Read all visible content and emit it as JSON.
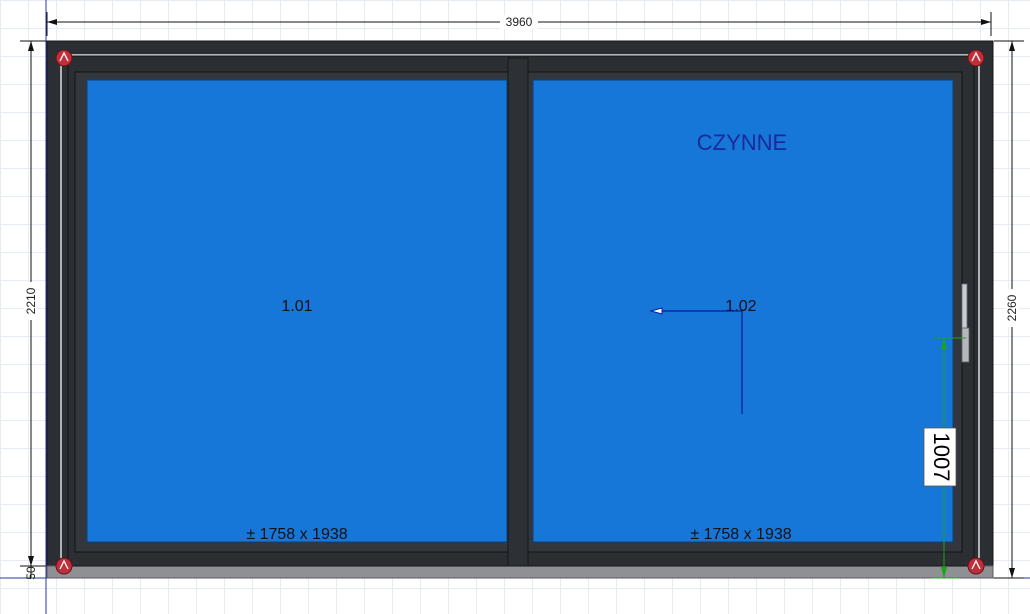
{
  "dimensions": {
    "total_width": "3960",
    "frame_height": "2210",
    "total_height": "2260",
    "bottom_offset": "50",
    "handle_height": "1007"
  },
  "sashes": [
    {
      "id": "1.01",
      "size": "± 1758 x 1938",
      "state": ""
    },
    {
      "id": "1.02",
      "size": "± 1758 x 1938",
      "state": "CZYNNE"
    }
  ],
  "colors": {
    "frame": "#2b2e33",
    "glass": "#1677d9",
    "dimension_line": "#111111",
    "handle_dimension": "#1aa51a",
    "direction_arrow": "#0a1aa0",
    "corner_marker": "#c0303a"
  },
  "icons": [
    "corner-marker-icon",
    "sliding-direction-arrow-icon",
    "handle-icon"
  ]
}
